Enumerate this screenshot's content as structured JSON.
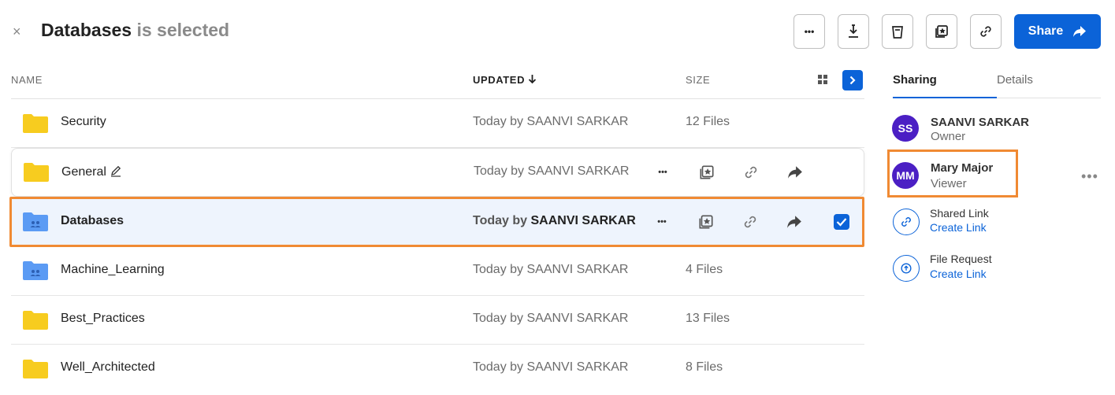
{
  "header": {
    "close_icon": "×",
    "selection_name": "Databases",
    "selection_suffix": " is selected",
    "toolbar": {
      "more_label": "•••",
      "share_label": "Share"
    }
  },
  "table": {
    "columns": {
      "name": "NAME",
      "updated": "UPDATED",
      "size": "SIZE"
    },
    "rows": [
      {
        "name": "Security",
        "updated": "Today by SAANVI SARKAR",
        "size": "12 Files",
        "folder_color": "#f7cc1f"
      },
      {
        "name": "General",
        "updated": "Today by SAANVI SARKAR",
        "size": "",
        "folder_color": "#f7cc1f"
      },
      {
        "name": "Databases",
        "updated_prefix": "Today by ",
        "updated_user": "SAANVI SARKAR",
        "size": "",
        "folder_color": "#5b9bf4"
      },
      {
        "name": "Machine_Learning",
        "updated": "Today by SAANVI SARKAR",
        "size": "4 Files",
        "folder_color": "#5b9bf4"
      },
      {
        "name": "Best_Practices",
        "updated": "Today by SAANVI SARKAR",
        "size": "13 Files",
        "folder_color": "#f7cc1f"
      },
      {
        "name": "Well_Architected",
        "updated": "Today by SAANVI SARKAR",
        "size": "8 Files",
        "folder_color": "#f7cc1f"
      }
    ],
    "row_more_label": "•••"
  },
  "right_panel": {
    "tabs": [
      "Sharing",
      "Details"
    ],
    "people": [
      {
        "initials": "SS",
        "name": "SAANVI SARKAR",
        "role": "Owner"
      },
      {
        "initials": "MM",
        "name": "Mary Major",
        "role": "Viewer"
      }
    ],
    "more_label": "•••",
    "shared_link": {
      "label": "Shared Link",
      "action": "Create Link"
    },
    "file_request": {
      "label": "File Request",
      "action": "Create Link"
    }
  },
  "colors": {
    "accent": "#0b63d8",
    "highlight": "#f08a33",
    "avatar": "#4b1fc4",
    "selected_row_bg": "#eef4fd"
  }
}
